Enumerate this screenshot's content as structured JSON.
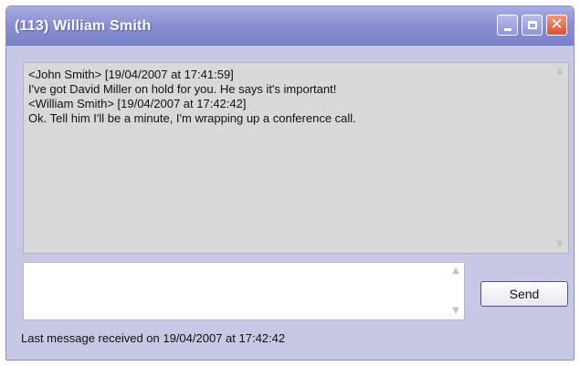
{
  "window": {
    "title": "(113) William Smith"
  },
  "chat": {
    "lines": [
      "<John Smith> [19/04/2007 at 17:41:59]",
      "I've got David Miller on hold for you. He says it's important!",
      "<William Smith> [19/04/2007 at 17:42:42]",
      "Ok. Tell him I'll be a minute, I'm wrapping up a conference call."
    ]
  },
  "message_input": {
    "value": ""
  },
  "buttons": {
    "send_label": "Send"
  },
  "status": {
    "text": "Last message received on 19/04/2007 at 17:42:42"
  },
  "icons": {
    "minimize": "minimize-icon",
    "maximize": "maximize-icon",
    "close": "close-icon",
    "scroll_up": "scroll-up-icon",
    "scroll_down": "scroll-down-icon"
  },
  "colors": {
    "titlebar": "#8c91d2",
    "window_bg": "#c7c8e6",
    "chat_bg": "#d8d8d8",
    "close_button": "#d9502f"
  }
}
